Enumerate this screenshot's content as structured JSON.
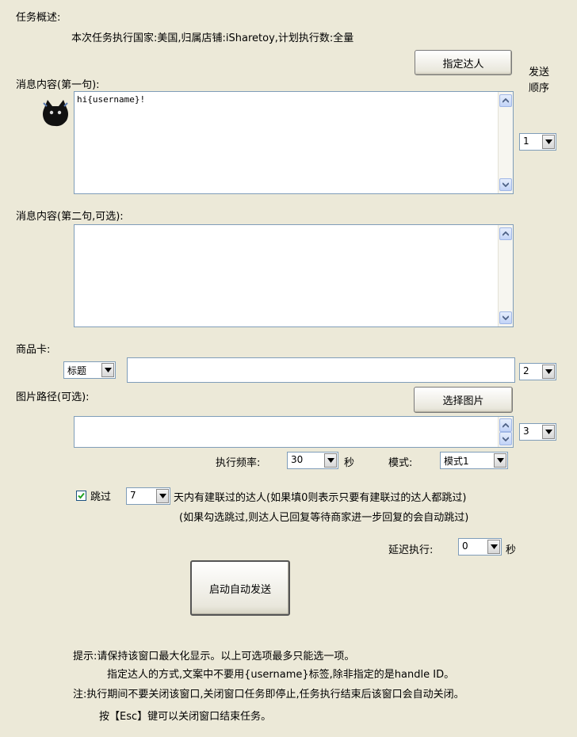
{
  "overview": {
    "title": "任务概述:",
    "detail": "本次任务执行国家:美国,归属店铺:iSharetoy,计划执行数:全量"
  },
  "message1": {
    "label": "消息内容(第一句):",
    "value": "hi{username}!"
  },
  "assign_button": "指定达人",
  "send_order_label": "发送\n顺序",
  "send_order": {
    "message1": "1",
    "product": "2",
    "image": "3"
  },
  "message2": {
    "label": "消息内容(第二句,可选):",
    "value": ""
  },
  "product_card": {
    "label": "商品卡:",
    "type_selected": "标题",
    "value": ""
  },
  "image_path": {
    "label": "图片路径(可选):",
    "button": "选择图片",
    "value": ""
  },
  "frequency": {
    "label": "执行频率:",
    "value": "30",
    "unit": "秒"
  },
  "mode": {
    "label": "模式:",
    "value": "模式1"
  },
  "skip": {
    "checked": true,
    "label": "跳过",
    "days": "7",
    "text": "天内有建联过的达人(如果填0则表示只要有建联过的达人都跳过)",
    "subtext": "(如果勾选跳过,则达人已回复等待商家进一步回复的会自动跳过)"
  },
  "delay": {
    "label": "延迟执行:",
    "value": "0",
    "unit": "秒"
  },
  "start_button": "启动自动发送",
  "tips": {
    "line1": "提示:请保持该窗口最大化显示。以上可选项最多只能选一项。",
    "line2": "指定达人的方式,文案中不要用{username}标签,除非指定的是handle ID。",
    "line3": "注:执行期间不要关闭该窗口,关闭窗口任务即停止,任务执行结束后该窗口会自动关闭。",
    "line4": "按【Esc】键可以关闭窗口结束任务。"
  }
}
